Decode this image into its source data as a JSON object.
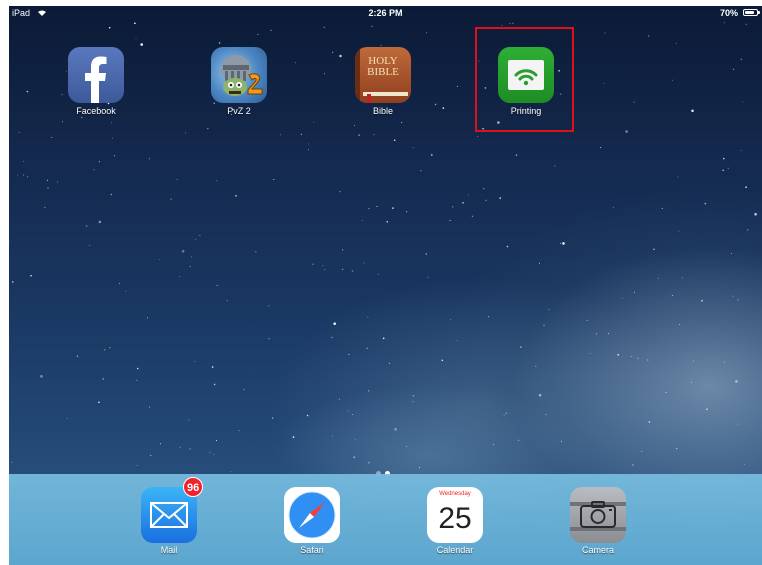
{
  "status_bar": {
    "carrier": "iPad",
    "time": "2:26 PM",
    "battery": "70%"
  },
  "home_apps": [
    {
      "label": "Facebook"
    },
    {
      "label": "PvZ 2"
    },
    {
      "label": "Bible",
      "icon_text_1": "HOLY",
      "icon_text_2": "BIBLE"
    },
    {
      "label": "Printing"
    }
  ],
  "dock_apps": [
    {
      "label": "Mail",
      "badge": "96"
    },
    {
      "label": "Safari"
    },
    {
      "label": "Calendar",
      "weekday": "Wednesday",
      "date": "25"
    },
    {
      "label": "Camera"
    }
  ],
  "page_indicator": {
    "pages": 2,
    "current": 2
  },
  "colors": {
    "highlight": "#e0101a",
    "badge": "#f0232a",
    "printing_green": "#1d8d24"
  }
}
